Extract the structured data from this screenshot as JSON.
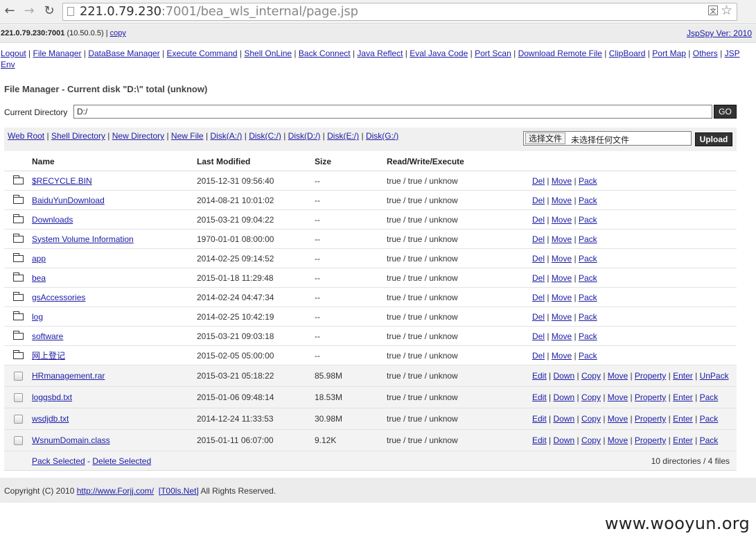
{
  "browser": {
    "url_host": "221.0.79.230",
    "url_rest": ":7001/bea_wls_internal/page.jsp"
  },
  "header": {
    "host": "221.0.79.230:7001",
    "ip": "(10.50.0.5)",
    "copy": "copy",
    "version": "JspSpy Ver: 2010"
  },
  "menu": [
    "Logout",
    "File Manager",
    "DataBase Manager",
    "Execute Command",
    "Shell OnLine",
    "Back Connect",
    "Java Reflect",
    "Eval Java Code",
    "Port Scan",
    "Download Remote File",
    "ClipBoard",
    "Port Map",
    "Others",
    "JSP Env"
  ],
  "page": {
    "title": "File Manager - Current disk \"D:\\\" total (unknow)",
    "dir_label": "Current Directory",
    "dir_value": "D:/",
    "go": "GO"
  },
  "toolbar": {
    "links": [
      "Web Root",
      "Shell Directory",
      "New Directory",
      "New File",
      "Disk(A:/)",
      "Disk(C:/)",
      "Disk(D:/)",
      "Disk(E:/)",
      "Disk(G:/)"
    ],
    "choose_file": "选择文件",
    "no_file": "未选择任何文件",
    "upload": "Upload"
  },
  "table": {
    "headers": [
      "Name",
      "Last Modified",
      "Size",
      "Read/Write/Execute"
    ],
    "dirs": [
      {
        "name": "$RECYCLE.BIN",
        "modified": "2015-12-31 09:56:40",
        "size": "--",
        "rwx": "true / true / unknow"
      },
      {
        "name": "BaiduYunDownload",
        "modified": "2014-08-21 10:01:02",
        "size": "--",
        "rwx": "true / true / unknow"
      },
      {
        "name": "Downloads",
        "modified": "2015-03-21 09:04:22",
        "size": "--",
        "rwx": "true / true / unknow"
      },
      {
        "name": "System Volume Information",
        "modified": "1970-01-01 08:00:00",
        "size": "--",
        "rwx": "true / true / unknow"
      },
      {
        "name": "app",
        "modified": "2014-02-25 09:14:52",
        "size": "--",
        "rwx": "true / true / unknow"
      },
      {
        "name": "bea",
        "modified": "2015-01-18 11:29:48",
        "size": "--",
        "rwx": "true / true / unknow"
      },
      {
        "name": "gsAccessories",
        "modified": "2014-02-24 04:47:34",
        "size": "--",
        "rwx": "true / true / unknow"
      },
      {
        "name": "log",
        "modified": "2014-02-25 10:42:19",
        "size": "--",
        "rwx": "true / true / unknow"
      },
      {
        "name": "software",
        "modified": "2015-03-21 09:03:18",
        "size": "--",
        "rwx": "true / true / unknow"
      },
      {
        "name": "网上登记",
        "modified": "2015-02-05 05:00:00",
        "size": "--",
        "rwx": "true / true / unknow"
      }
    ],
    "dir_actions": [
      "Del",
      "Move",
      "Pack"
    ],
    "files": [
      {
        "name": "HRmanagement.rar",
        "modified": "2015-03-21 05:18:22",
        "size": "85.98M",
        "rwx": "true / true / unknow",
        "actions": [
          "Edit",
          "Down",
          "Copy",
          "Move",
          "Property",
          "Enter",
          "UnPack"
        ]
      },
      {
        "name": "loggsbd.txt",
        "modified": "2015-01-06 09:48:14",
        "size": "18.53M",
        "rwx": "true / true / unknow",
        "actions": [
          "Edit",
          "Down",
          "Copy",
          "Move",
          "Property",
          "Enter",
          "Pack"
        ]
      },
      {
        "name": "wsdjdb.txt",
        "modified": "2014-12-24 11:33:53",
        "size": "30.98M",
        "rwx": "true / true / unknow",
        "actions": [
          "Edit",
          "Down",
          "Copy",
          "Move",
          "Property",
          "Enter",
          "Pack"
        ]
      },
      {
        "name": "WsnumDomain.class",
        "modified": "2015-01-11 06:07:00",
        "size": "9.12K",
        "rwx": "true / true / unknow",
        "actions": [
          "Edit",
          "Down",
          "Copy",
          "Move",
          "Property",
          "Enter",
          "Pack"
        ]
      }
    ],
    "pack_selected": "Pack Selected",
    "delete_selected": "Delete Selected",
    "summary": "10 directories / 4 files"
  },
  "footer": {
    "prefix": "Copyright (C) 2010",
    "link1": "http://www.Forjj.com/",
    "link2": "[T00ls.Net]",
    "suffix": "All Rights Reserved."
  },
  "watermark": "www.wooyun.org"
}
